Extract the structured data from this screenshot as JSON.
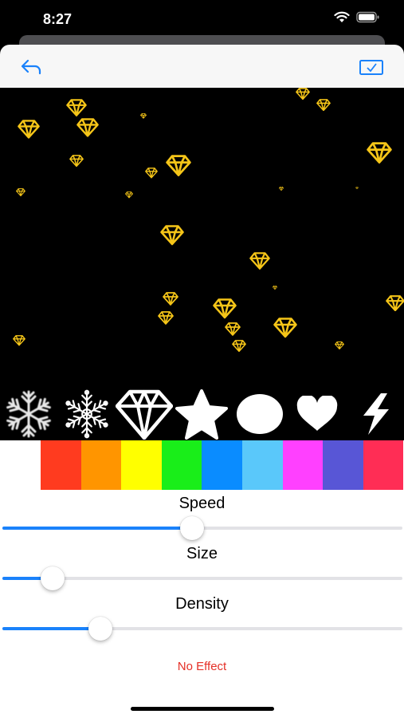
{
  "status_bar": {
    "time": "8:27",
    "icons": [
      "wifi-icon",
      "battery-icon"
    ]
  },
  "nav": {
    "back_icon": "undo-arrow-icon",
    "done_icon": "checkmark-square-icon",
    "tint": "#1a82fb"
  },
  "canvas": {
    "particle_icon": "diamond-icon",
    "particle_color": "#f5c518",
    "background": "#000000"
  },
  "shapes": [
    {
      "name": "snowflake-fuzzy",
      "icon": "snowflake-icon"
    },
    {
      "name": "snowflake",
      "icon": "snowflake-icon"
    },
    {
      "name": "diamond",
      "icon": "diamond-icon",
      "selected": true
    },
    {
      "name": "star",
      "icon": "star-icon"
    },
    {
      "name": "circle",
      "icon": "circle-icon"
    },
    {
      "name": "heart",
      "icon": "heart-icon"
    },
    {
      "name": "lightning",
      "icon": "lightning-icon"
    }
  ],
  "colors": [
    "#ffffff",
    "#ff3b1f",
    "#ff9500",
    "#ffff00",
    "#19ee19",
    "#0a8cff",
    "#5ac8fa",
    "#ff40ff",
    "#5856d6",
    "#ff2d55"
  ],
  "sliders": [
    {
      "label": "Speed",
      "value": 0.475
    },
    {
      "label": "Size",
      "value": 0.125
    },
    {
      "label": "Density",
      "value": 0.245
    }
  ],
  "no_effect_label": "No Effect",
  "accent_red": "#e53027"
}
